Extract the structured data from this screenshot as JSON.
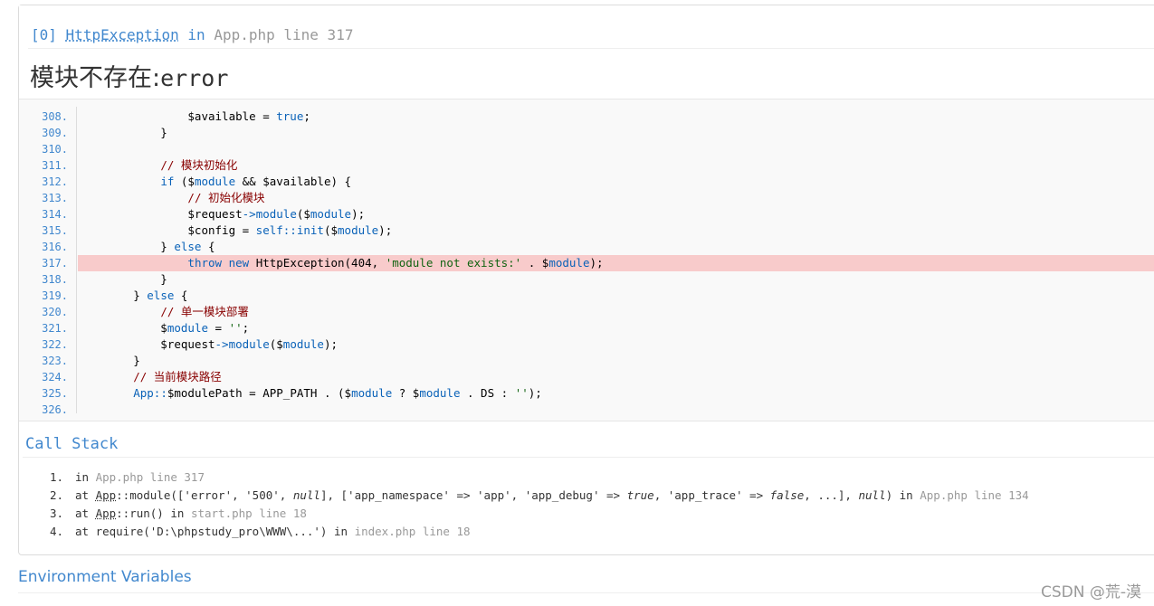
{
  "exception": {
    "index": "[0]",
    "class_name": "HttpException",
    "in_word": "in",
    "location": "App.php line 317",
    "message_cn": "模块不存在:",
    "message_en": "error"
  },
  "source": {
    "highlight_line": "317.",
    "lines": [
      {
        "no": "308.",
        "code": "                $available = true;"
      },
      {
        "no": "309.",
        "code": "            }"
      },
      {
        "no": "310.",
        "code": ""
      },
      {
        "no": "311.",
        "code": "            // 模块初始化"
      },
      {
        "no": "312.",
        "code": "            if ($module && $available) {"
      },
      {
        "no": "313.",
        "code": "                // 初始化模块"
      },
      {
        "no": "314.",
        "code": "                $request->module($module);"
      },
      {
        "no": "315.",
        "code": "                $config = self::init($module);"
      },
      {
        "no": "316.",
        "code": "            } else {"
      },
      {
        "no": "317.",
        "code": "                throw new HttpException(404, 'module not exists:' . $module);"
      },
      {
        "no": "318.",
        "code": "            }"
      },
      {
        "no": "319.",
        "code": "        } else {"
      },
      {
        "no": "320.",
        "code": "            // 单一模块部署"
      },
      {
        "no": "321.",
        "code": "            $module = '';"
      },
      {
        "no": "322.",
        "code": "            $request->module($module);"
      },
      {
        "no": "323.",
        "code": "        }"
      },
      {
        "no": "324.",
        "code": "        // 当前模块路径"
      },
      {
        "no": "325.",
        "code": "        App::$modulePath = APP_PATH . ($module ? $module . DS : '');"
      },
      {
        "no": "326.",
        "code": ""
      }
    ]
  },
  "call_stack": {
    "title": "Call Stack",
    "items": [
      {
        "num": "1.",
        "pre": "in ",
        "loc": "App.php line 317"
      },
      {
        "num": "2.",
        "pre": "at ",
        "cls": "App",
        "call": "::module(['error', '500', ",
        "null1": "null",
        "mid": "], ['app_namespace' => 'app', 'app_debug' => ",
        "true1": "true",
        "mid2": ", 'app_trace' => ",
        "false1": "false",
        "mid3": ", ...], ",
        "null2": "null",
        "end": ") in ",
        "loc": "App.php line 134"
      },
      {
        "num": "3.",
        "pre": "at ",
        "cls": "App",
        "call": "::run() in ",
        "loc": "start.php line 18"
      },
      {
        "num": "4.",
        "pre": "at ",
        "call": "require('D:\\phpstudy_pro\\WWW\\...') in ",
        "loc": "index.php line 18"
      }
    ]
  },
  "environment": {
    "title": "Environment Variables"
  },
  "watermark": "CSDN @荒-漠",
  "colors": {
    "accent": "#4288ce",
    "highlight": "#f8cbcb",
    "keyword": "#0a62b8",
    "string": "#116311",
    "comment": "#880000"
  }
}
